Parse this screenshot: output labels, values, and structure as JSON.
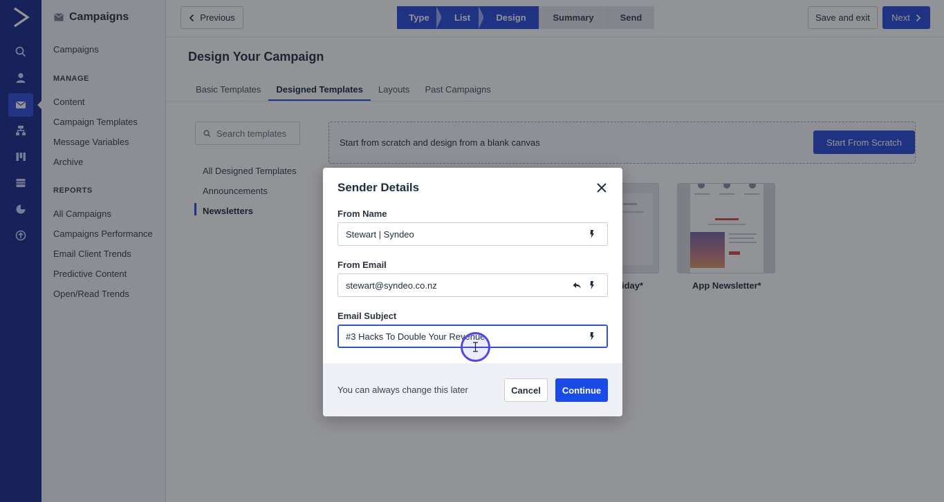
{
  "nav_rail": {
    "items": [
      {
        "icon": "search-icon"
      },
      {
        "icon": "contacts-icon"
      },
      {
        "icon": "campaigns-icon",
        "active": true
      },
      {
        "icon": "automations-icon"
      },
      {
        "icon": "deals-icon"
      },
      {
        "icon": "lists-icon"
      },
      {
        "icon": "reports-icon"
      },
      {
        "icon": "apps-icon"
      }
    ],
    "color": "#1e2f8f",
    "active_color": "#3550d8"
  },
  "sidebar": {
    "title": "Campaigns",
    "top_link": "Campaigns",
    "manage_heading": "MANAGE",
    "manage_items": [
      "Content",
      "Campaign Templates",
      "Message Variables",
      "Archive"
    ],
    "reports_heading": "REPORTS",
    "reports_items": [
      "All Campaigns",
      "Campaigns Performance",
      "Email Client Trends",
      "Predictive Content",
      "Open/Read Trends"
    ]
  },
  "topbar": {
    "previous_label": "Previous",
    "steps": [
      {
        "label": "Type",
        "state": "done"
      },
      {
        "label": "List",
        "state": "done"
      },
      {
        "label": "Design",
        "state": "done"
      },
      {
        "label": "Summary",
        "state": "todo"
      },
      {
        "label": "Send",
        "state": "todo"
      }
    ],
    "save_exit_label": "Save and exit",
    "next_label": "Next"
  },
  "main": {
    "page_title": "Design Your Campaign",
    "tabs": [
      {
        "label": "Basic Templates"
      },
      {
        "label": "Designed Templates",
        "active": true
      },
      {
        "label": "Layouts"
      },
      {
        "label": "Past Campaigns"
      }
    ],
    "search_placeholder": "Search templates",
    "filters": [
      {
        "label": "All Designed Templates"
      },
      {
        "label": "Announcements"
      },
      {
        "label": "Newsletters",
        "active": true
      }
    ],
    "scratch_text": "Start from scratch and design from a blank canvas",
    "scratch_button": "Start From Scratch",
    "templates": [
      {
        "label": "iday*"
      },
      {
        "label": "App Newsletter*"
      }
    ]
  },
  "modal": {
    "title": "Sender Details",
    "from_name_label": "From Name",
    "from_name_value": "Stewart | Syndeo",
    "from_email_label": "From Email",
    "from_email_value": "stewart@syndeo.co.nz",
    "subject_label": "Email Subject",
    "subject_value": "#3 Hacks To Double Your Revenue",
    "footer_note": "You can always change this later",
    "cancel_label": "Cancel",
    "continue_label": "Continue"
  },
  "colors": {
    "primary": "#2d4fd9",
    "continue": "#1b4be6",
    "overlay": "rgba(18, 20, 28, 0.46)",
    "cursor_ring": "#4f46e5"
  }
}
